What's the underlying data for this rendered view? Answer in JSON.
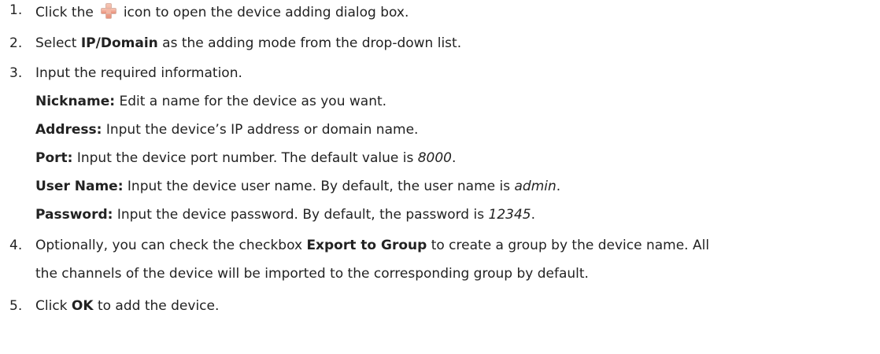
{
  "steps": [
    {
      "num": "1.",
      "pre": "Click the",
      "icon": "add-plus-icon",
      "post": "icon to open the device adding dialog box."
    },
    {
      "num": "2.",
      "pre": "Select ",
      "bold": "IP/Domain",
      "post": " as the adding mode from the drop-down list."
    },
    {
      "num": "3.",
      "text": "Input the required information.",
      "fields": [
        {
          "label": "Nickname:",
          "desc": " Edit a name for the device as you want.",
          "value": "",
          "end": ""
        },
        {
          "label": "Address:",
          "desc": " Input the device’s IP address or domain name.",
          "value": "",
          "end": ""
        },
        {
          "label": "Port:",
          "desc": " Input the device port number. The default value is ",
          "value": "8000",
          "end": "."
        },
        {
          "label": "User Name:",
          "desc": " Input the device user name. By default, the user name is ",
          "value": "admin",
          "end": "."
        },
        {
          "label": "Password:",
          "desc": " Input the device password. By default, the password is ",
          "value": "12345",
          "end": "."
        }
      ]
    },
    {
      "num": "4.",
      "pre": "Optionally, you can check the checkbox ",
      "bold": "Export to Group",
      "post": " to create a group by the device name. All",
      "line2": "the channels of the device will be imported to the corresponding group by default."
    },
    {
      "num": "5.",
      "pre": "Click ",
      "bold": "OK",
      "post": " to add the device."
    }
  ]
}
